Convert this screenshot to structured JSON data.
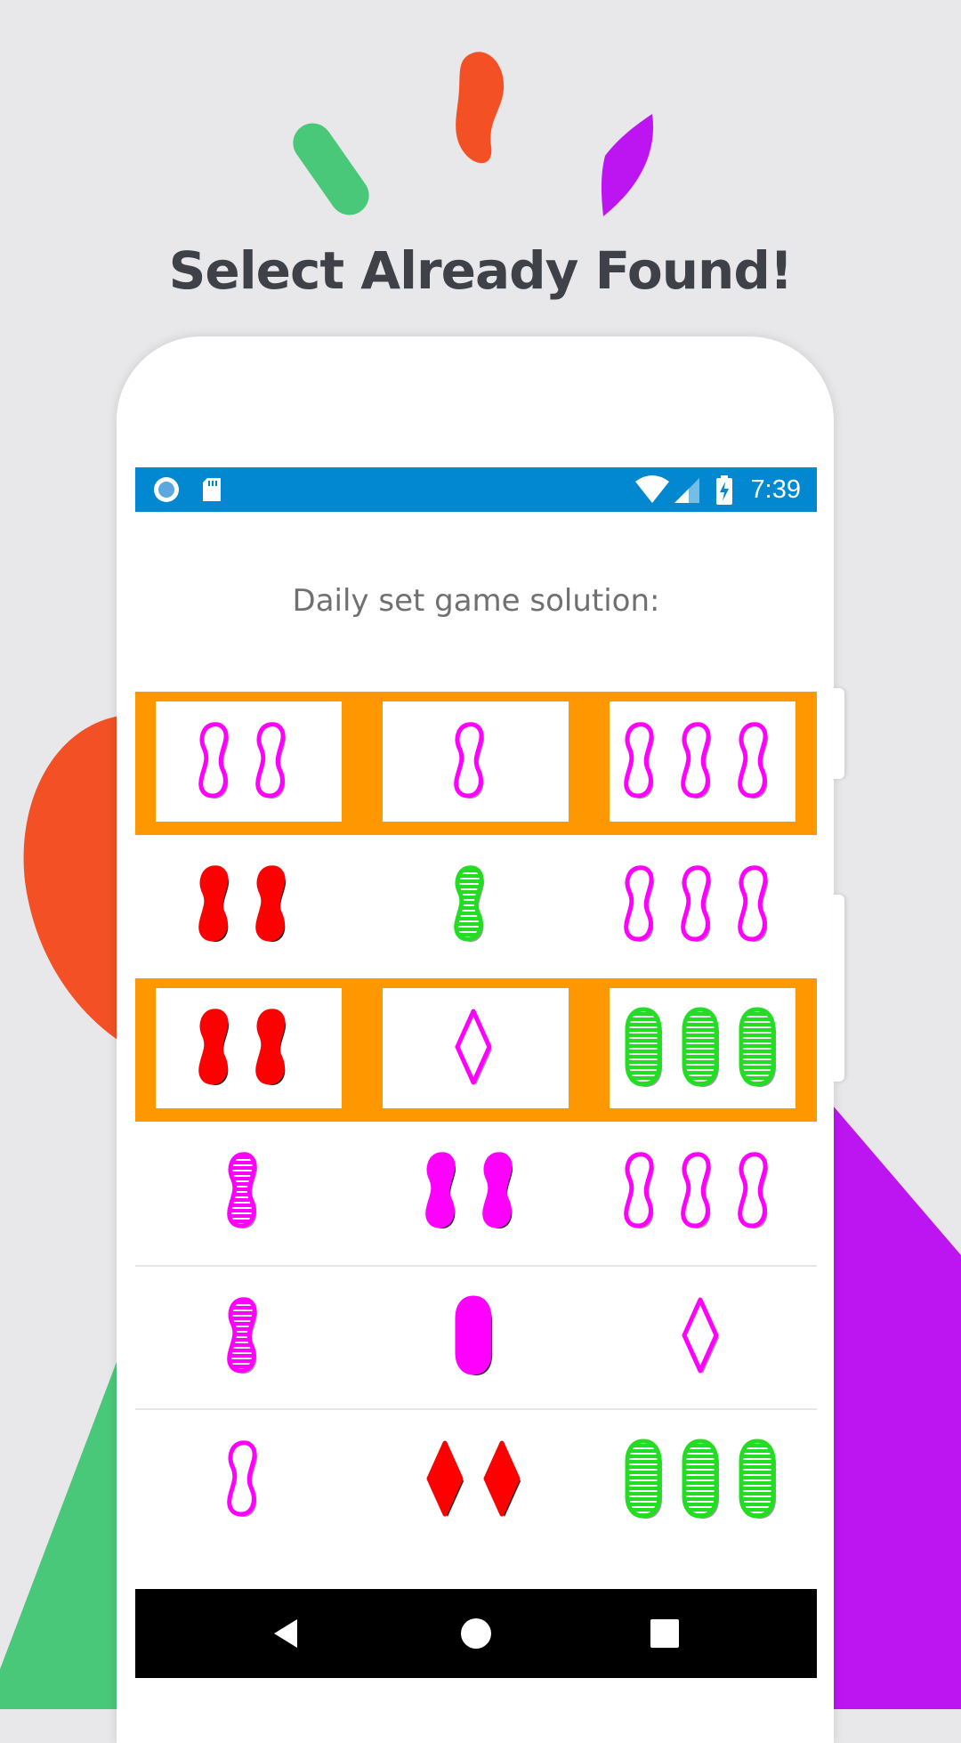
{
  "headline": "Select Already Found!",
  "status_bar": {
    "time": "7:39",
    "left_icons": [
      "sync-circle-icon",
      "sd-card-icon"
    ],
    "right_icons": [
      "wifi-icon",
      "cell-signal-icon",
      "battery-charging-icon"
    ]
  },
  "screen_title": "Daily set game solution:",
  "colors": {
    "status_bar": "#0288d1",
    "highlight": "#ff9800",
    "card_red": "#ff0000",
    "card_green": "#22dd22",
    "card_magenta": "#ff00ff",
    "deco_green": "#4ac87a",
    "deco_orange": "#f35026",
    "deco_purple": "#bd15f2"
  },
  "cards": [
    {
      "row": 1,
      "highlighted": true,
      "items": [
        {
          "count": 2,
          "shape": "squiggle",
          "fill": "outline",
          "color": "magenta"
        },
        {
          "count": 1,
          "shape": "squiggle",
          "fill": "outline",
          "color": "magenta"
        },
        {
          "count": 3,
          "shape": "squiggle",
          "fill": "outline",
          "color": "magenta"
        }
      ]
    },
    {
      "row": 2,
      "highlighted": false,
      "items": [
        {
          "count": 2,
          "shape": "squiggle",
          "fill": "solid",
          "color": "red"
        },
        {
          "count": 1,
          "shape": "squiggle",
          "fill": "striped",
          "color": "green"
        },
        {
          "count": 3,
          "shape": "squiggle",
          "fill": "outline",
          "color": "magenta"
        }
      ]
    },
    {
      "row": 3,
      "highlighted": true,
      "items": [
        {
          "count": 2,
          "shape": "squiggle",
          "fill": "solid",
          "color": "red"
        },
        {
          "count": 1,
          "shape": "diamond",
          "fill": "outline",
          "color": "magenta"
        },
        {
          "count": 3,
          "shape": "oval",
          "fill": "striped",
          "color": "green"
        }
      ]
    },
    {
      "row": 4,
      "highlighted": false,
      "items": [
        {
          "count": 1,
          "shape": "squiggle",
          "fill": "striped",
          "color": "magenta"
        },
        {
          "count": 2,
          "shape": "squiggle",
          "fill": "solid",
          "color": "magenta"
        },
        {
          "count": 3,
          "shape": "squiggle",
          "fill": "outline",
          "color": "magenta"
        }
      ]
    },
    {
      "row": 5,
      "highlighted": false,
      "items": [
        {
          "count": 1,
          "shape": "squiggle",
          "fill": "striped",
          "color": "magenta"
        },
        {
          "count": 1,
          "shape": "oval",
          "fill": "solid",
          "color": "magenta"
        },
        {
          "count": 1,
          "shape": "diamond",
          "fill": "outline",
          "color": "magenta"
        }
      ]
    },
    {
      "row": 6,
      "highlighted": false,
      "items": [
        {
          "count": 1,
          "shape": "squiggle",
          "fill": "outline",
          "color": "magenta"
        },
        {
          "count": 2,
          "shape": "diamond",
          "fill": "solid",
          "color": "red"
        },
        {
          "count": 3,
          "shape": "oval",
          "fill": "striped",
          "color": "green"
        }
      ]
    }
  ],
  "nav_bar": {
    "buttons": [
      "back-icon",
      "home-icon",
      "recents-icon"
    ]
  }
}
